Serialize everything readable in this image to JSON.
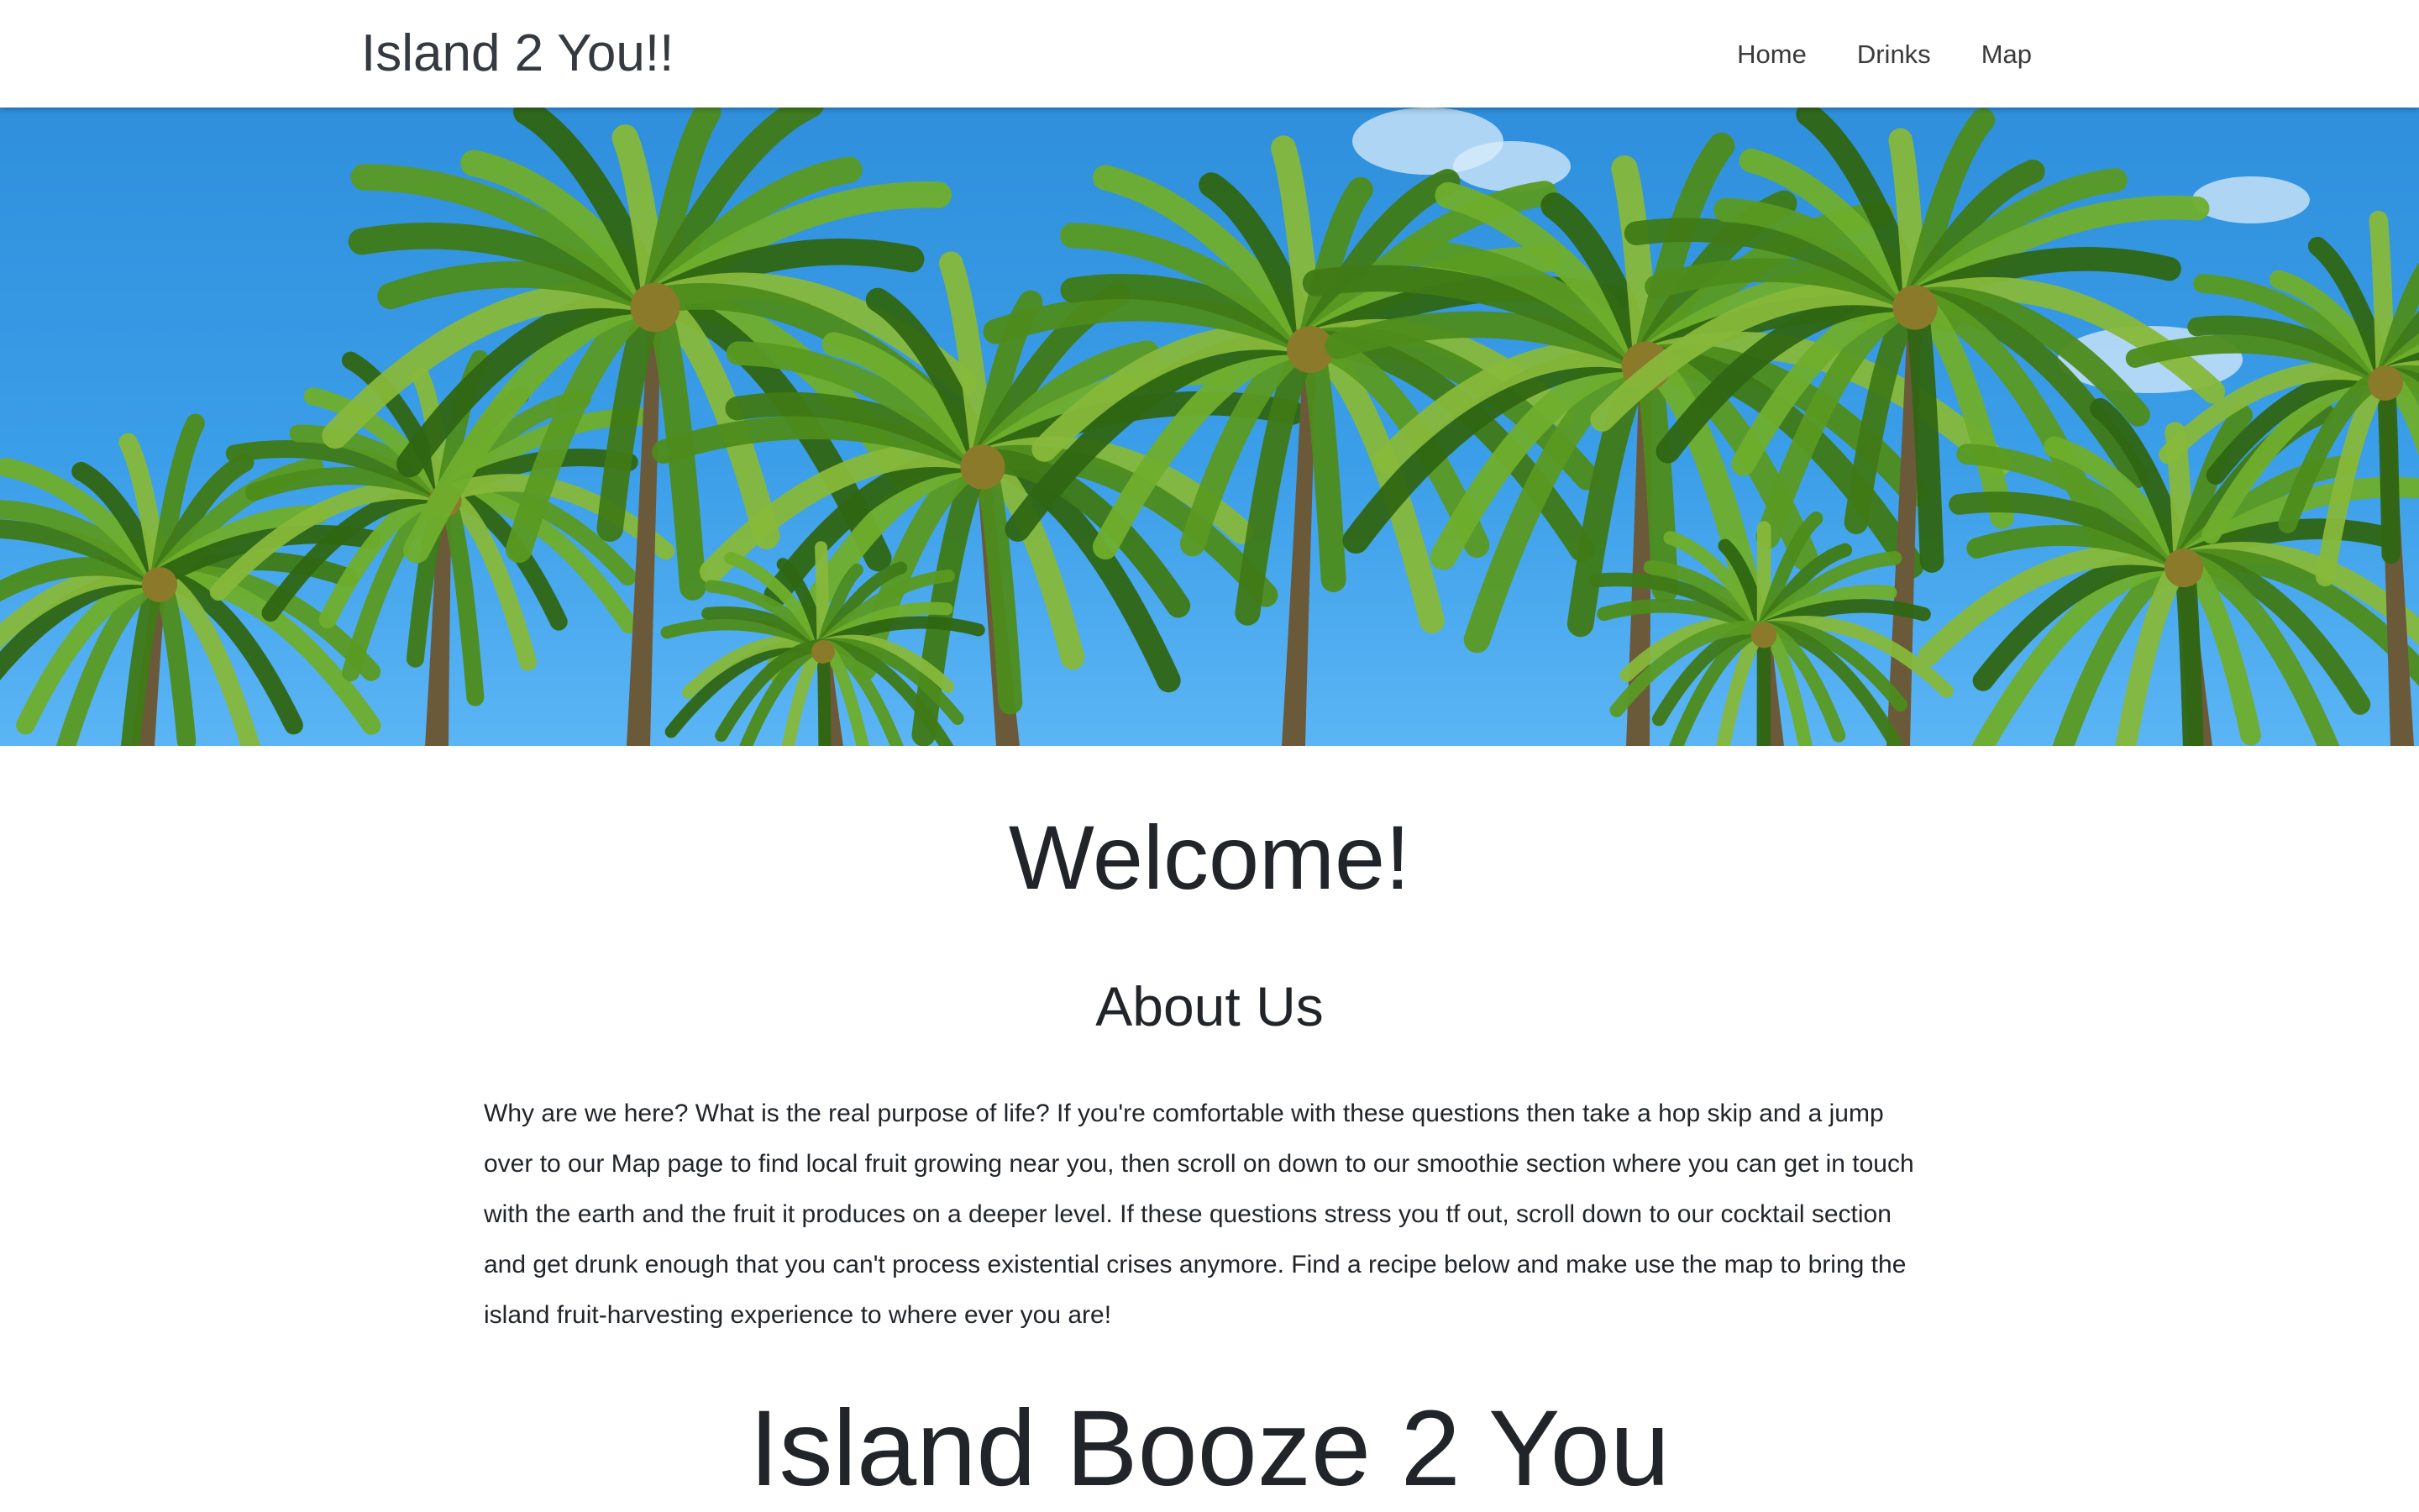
{
  "navbar": {
    "brand": "Island 2 You!!",
    "links": [
      "Home",
      "Drinks",
      "Map"
    ]
  },
  "hero": {
    "image": "palm-trees-banner",
    "sky_color": "#3b9ee8",
    "foliage_color": "#4f8a1c"
  },
  "main": {
    "welcome_heading": "Welcome!",
    "about_heading": "About Us",
    "about_text": "Why are we here? What is the real purpose of life? If you're comfortable with these questions then take a hop skip and a jump over to our Map page to find local fruit growing near you, then scroll on down to our smoothie section where you can get in touch with the earth and the fruit it produces on a deeper level. If these questions stress you tf out, scroll down to our cocktail section and get drunk enough that you can't process existential crises anymore. Find a recipe below and make use the map to bring the island fruit-harvesting experience to where ever you are!",
    "section_heading": "Island Booze 2 You"
  }
}
